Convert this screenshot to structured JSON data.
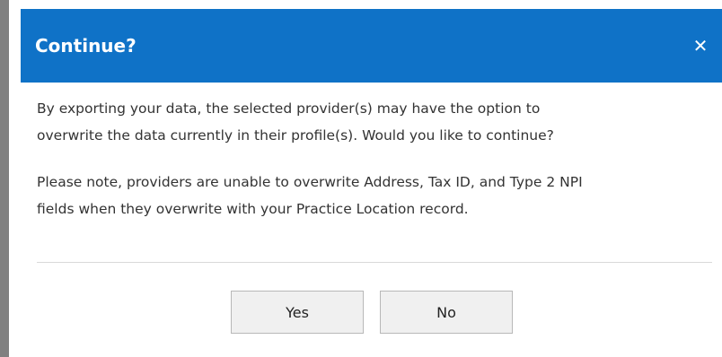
{
  "dialog": {
    "title": "Continue?",
    "close_glyph": "✕",
    "close_icon": "close-icon",
    "paragraph_1_line_1": "By exporting your data, the selected provider(s) may have the option to",
    "paragraph_1_line_2": "overwrite the data currently in their profile(s). Would you like to continue?",
    "paragraph_2_line_1": "Please note, providers are unable to overwrite Address, Tax ID, and Type 2 NPI",
    "paragraph_2_line_2": "fields when they overwrite with your Practice Location record.",
    "yes_label": "Yes",
    "no_label": "No"
  },
  "colors": {
    "header": "#0f72c7",
    "header_text": "#ffffff",
    "body_text": "#333333",
    "button_bg": "#f0f0f0",
    "button_border": "#b8b8b8",
    "left_bar": "#808080"
  }
}
